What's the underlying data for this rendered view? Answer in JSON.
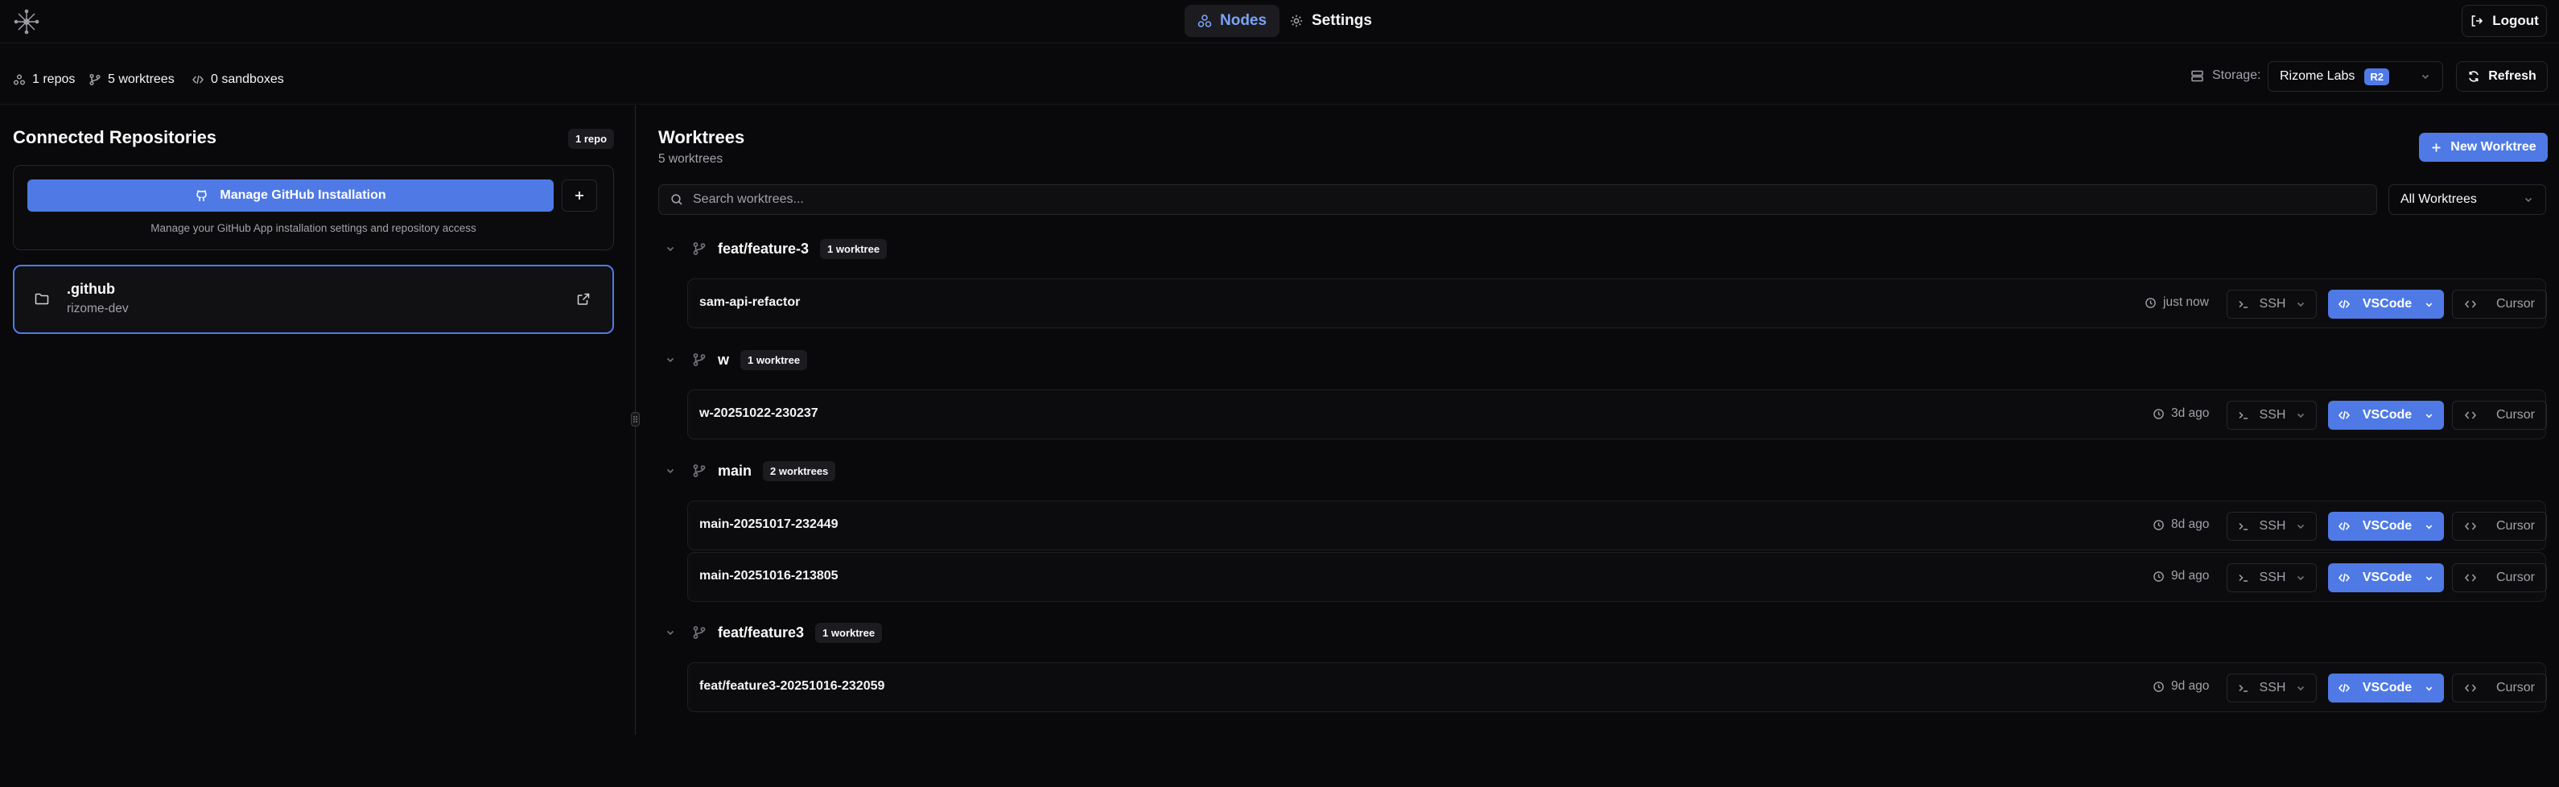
{
  "nav": {
    "tabs": [
      {
        "label": "Nodes",
        "icon": "nodes-icon",
        "active": true
      },
      {
        "label": "Settings",
        "icon": "gear-icon",
        "active": false
      }
    ],
    "logout_label": "Logout"
  },
  "stats": {
    "repos": "1 repos",
    "worktrees": "5 worktrees",
    "sandboxes": "0 sandboxes"
  },
  "storage": {
    "label": "Storage:",
    "value": "Rizome Labs",
    "badge": "R2"
  },
  "refresh_label": "Refresh",
  "left_panel": {
    "title": "Connected Repositories",
    "count_badge": "1 repo",
    "github_button": "Manage GitHub Installation",
    "github_hint": "Manage your GitHub App installation settings and repository access",
    "repo": {
      "name": ".github",
      "owner": "rizome-dev"
    }
  },
  "right_panel": {
    "title": "Worktrees",
    "subtitle": "5 worktrees",
    "new_button": "New Worktree",
    "search_placeholder": "Search worktrees...",
    "filter_value": "All Worktrees",
    "groups": [
      {
        "name": "feat/feature-3",
        "count": "1 worktree",
        "rows": [
          {
            "name": "sam-api-refactor",
            "time": "just now"
          }
        ]
      },
      {
        "name": "w",
        "count": "1 worktree",
        "rows": [
          {
            "name": "w-20251022-230237",
            "time": "3d ago"
          }
        ]
      },
      {
        "name": "main",
        "count": "2 worktrees",
        "rows": [
          {
            "name": "main-20251017-232449",
            "time": "8d ago"
          },
          {
            "name": "main-20251016-213805",
            "time": "9d ago"
          }
        ]
      },
      {
        "name": "feat/feature3",
        "count": "1 worktree",
        "rows": [
          {
            "name": "feat/feature3-20251016-232059",
            "time": "9d ago"
          }
        ]
      }
    ],
    "ssh_label": "SSH",
    "vscode_label": "VSCode",
    "cursor_label": "Cursor"
  },
  "colors": {
    "background": "#09090b",
    "accent": "#4f7ae6",
    "active_tab_text": "#7ca2f5",
    "border": "#27272a"
  }
}
